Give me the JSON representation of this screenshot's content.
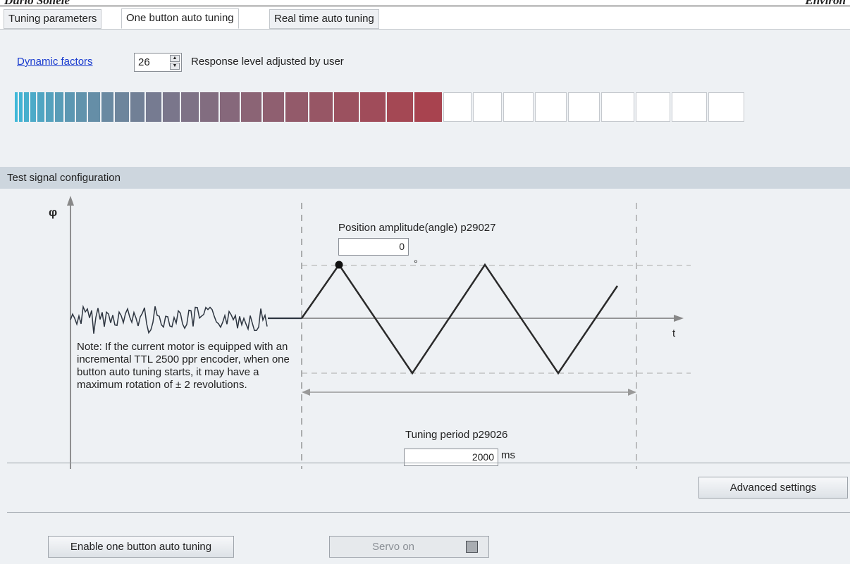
{
  "page_header": {
    "left": "Durio Soliele",
    "right": "Environ"
  },
  "tabs": [
    {
      "label": "Tuning parameters",
      "active": false
    },
    {
      "label": "One button auto tuning",
      "active": true
    },
    {
      "label": "Real time auto tuning",
      "active": false
    }
  ],
  "dynamic": {
    "link_label": "Dynamic factors",
    "value": "26",
    "label": "Response level adjusted by user",
    "filled_segments": 26,
    "total_segments": 35,
    "color_start": "#3fb8d8",
    "color_end": "#a8434f"
  },
  "test_signal": {
    "section_title": "Test signal configuration",
    "y_axis_label": "φ",
    "x_axis_label": "t",
    "amplitude_label": "Position amplitude(angle) p29027",
    "amplitude_value": "0",
    "amplitude_unit": "°",
    "note": "Note: If the current motor is equipped with an incremental TTL 2500 ppr encoder, when one button auto tuning starts, it may have a maximum rotation of ± 2 revolutions.",
    "period_label": "Tuning period p29026",
    "period_value": "2000",
    "period_unit": "ms"
  },
  "buttons": {
    "advanced": "Advanced settings",
    "enable": "Enable one button auto tuning",
    "servo_on": "Servo on"
  }
}
